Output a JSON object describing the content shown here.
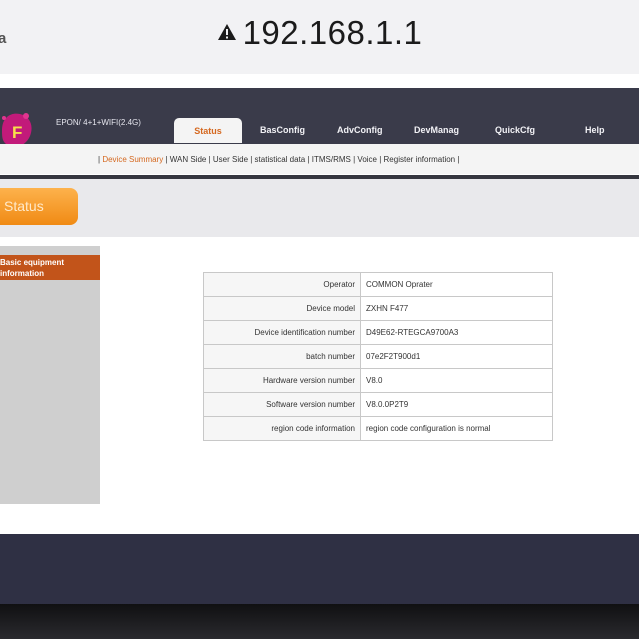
{
  "browser": {
    "url": "192.168.1.1",
    "left_fragment": "a",
    "warning_icon": "warning-triangle-icon"
  },
  "header": {
    "product": "EPON/ 4+1+WIFI(2.4G)",
    "logo_letter": "F",
    "nav": [
      {
        "label": "Status",
        "active": true
      },
      {
        "label": "BasConfig",
        "active": false
      },
      {
        "label": "AdvConfig",
        "active": false
      },
      {
        "label": "DevManag",
        "active": false
      },
      {
        "label": "QuickCfg",
        "active": false
      },
      {
        "label": "Help",
        "active": false
      }
    ]
  },
  "subnav": {
    "items": [
      "Device Summary",
      "WAN Side",
      "User Side",
      "statistical data",
      "ITMS/RMS",
      "Voice",
      "Register information"
    ],
    "selected": "Device Summary"
  },
  "status_button": "Status",
  "sidebar": {
    "items": [
      {
        "line1": "Basic equipment",
        "line2": "information"
      }
    ]
  },
  "device_info": [
    {
      "label": "Operator",
      "value": "COMMON Oprater"
    },
    {
      "label": "Device model",
      "value": "ZXHN F477"
    },
    {
      "label": "Device identification number",
      "value": "D49E62-RTEGCA9700A3"
    },
    {
      "label": "batch number",
      "value": "07e2F2T900d1"
    },
    {
      "label": "Hardware version number",
      "value": "V8.0"
    },
    {
      "label": "Software version number",
      "value": "V8.0.0P2T9"
    },
    {
      "label": "region code information",
      "value": "region code configuration is normal"
    }
  ],
  "colors": {
    "banner": "#3a3b4a",
    "accent_orange": "#d5681f",
    "status_button": "#f4961f",
    "sidebar_active": "#c2541a"
  }
}
